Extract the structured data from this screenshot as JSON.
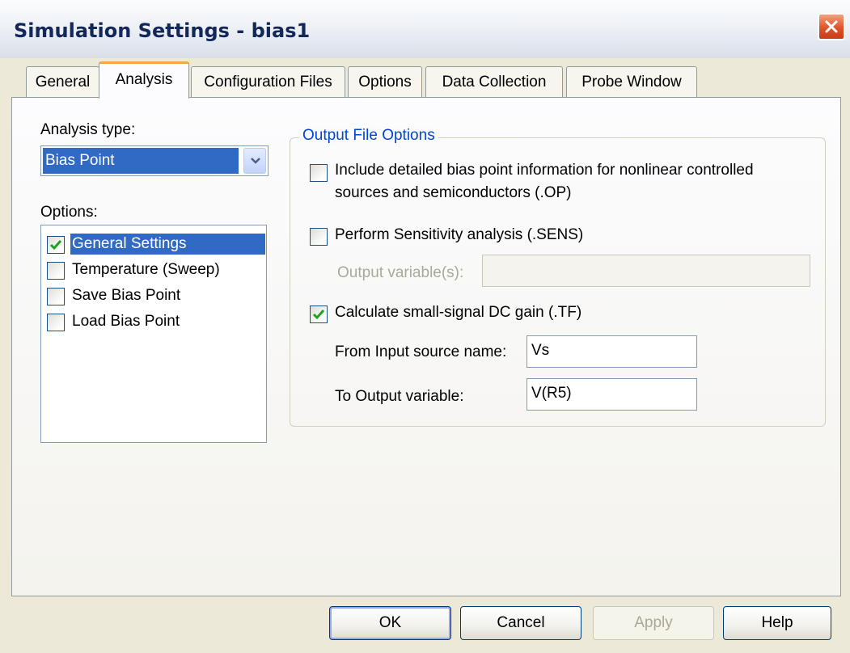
{
  "window": {
    "title": "Simulation Settings - bias1"
  },
  "tabs": [
    {
      "label": "General"
    },
    {
      "label": "Analysis",
      "active": true
    },
    {
      "label": "Configuration Files"
    },
    {
      "label": "Options"
    },
    {
      "label": "Data Collection"
    },
    {
      "label": "Probe Window"
    }
  ],
  "analysis": {
    "type_label": "Analysis type:",
    "type_value": "Bias Point",
    "options_label": "Options:",
    "options": [
      {
        "label": "General Settings",
        "checked": true,
        "selected": true
      },
      {
        "label": "Temperature (Sweep)",
        "checked": false
      },
      {
        "label": "Save Bias Point",
        "checked": false
      },
      {
        "label": "Load Bias Point",
        "checked": false
      }
    ]
  },
  "output_options": {
    "group_title": "Output File Options",
    "include_bias_line1": "Include detailed bias point information for nonlinear controlled",
    "include_bias_line2": "sources and semiconductors (.OP)",
    "include_bias_checked": false,
    "sensitivity_label": "Perform Sensitivity analysis (.SENS)",
    "sensitivity_checked": false,
    "output_variables_label": "Output variable(s):",
    "output_variables_value": "",
    "dc_gain_label": "Calculate small-signal DC gain (.TF)",
    "dc_gain_checked": true,
    "input_source_label": "From Input source name:",
    "input_source_value": "Vs",
    "output_variable_label": "To Output variable:",
    "output_variable_value": "V(R5)"
  },
  "buttons": {
    "ok": "OK",
    "cancel": "Cancel",
    "apply": "Apply",
    "help": "Help"
  },
  "colors": {
    "selection": "#316AC5",
    "group_title": "#0046D5",
    "dialog_background": "#ECE9D8",
    "close_button": "#E0542B",
    "active_tab_accent": "#F4A742"
  },
  "icons": {
    "close": "close-x-icon",
    "dropdown": "chevron-down-icon",
    "check": "checkmark-icon"
  }
}
